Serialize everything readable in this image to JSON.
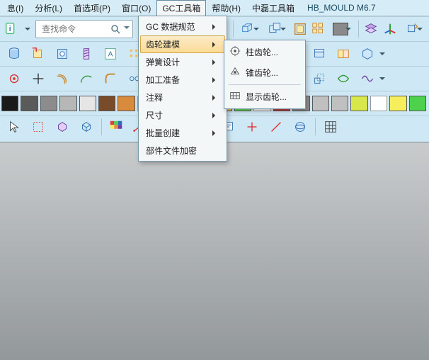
{
  "app": {
    "title": "HB_MOULD M6.7"
  },
  "menubar": {
    "items": [
      {
        "label": "息(I)"
      },
      {
        "label": "分析(L)"
      },
      {
        "label": "首选项(P)"
      },
      {
        "label": "窗口(O)"
      },
      {
        "label": "GC工具箱"
      },
      {
        "label": "帮助(H)"
      },
      {
        "label": "中磊工具箱"
      }
    ]
  },
  "search": {
    "placeholder": "查找命令",
    "value": ""
  },
  "dropdown": {
    "items": [
      {
        "label": "GC 数据规范",
        "submenu": true
      },
      {
        "label": "齿轮建模",
        "submenu": true,
        "highlight": true
      },
      {
        "label": "弹簧设计",
        "submenu": true
      },
      {
        "label": "加工准备",
        "submenu": true
      },
      {
        "label": "注释",
        "submenu": true
      },
      {
        "label": "尺寸",
        "submenu": true
      },
      {
        "label": "批量创建",
        "submenu": true
      },
      {
        "label": "部件文件加密",
        "submenu": false
      }
    ],
    "sub_items": [
      {
        "label": "柱齿轮...",
        "icon": "gear-cyl-icon"
      },
      {
        "label": "锥齿轮...",
        "icon": "gear-bevel-icon"
      },
      {
        "label": "显示齿轮...",
        "icon": "gear-show-icon"
      }
    ]
  },
  "toolbar": {
    "info_btn": "i",
    "row1_names": [
      "start-icon",
      "sketch-icon",
      "sketch-plane-icon",
      "datum-icon",
      "extrude-icon",
      "extrude-dd-icon",
      "unite-icon",
      "subtract-icon",
      "shell-icon",
      "pattern-icon",
      "mirror-icon",
      "color-dd-icon",
      "layer-icon",
      "axis-icon",
      "move-icon"
    ],
    "row2_names": [
      "cylinder-icon",
      "wrap-icon",
      "hole-icon",
      "thread-icon",
      "text-icon",
      "array-icon",
      "mesh-icon",
      "dash-icon",
      "trim-icon",
      "extend-icon",
      "fillet-icon",
      "chamfer-icon",
      "surface-icon",
      "thicken-icon",
      "sew-icon",
      "intersect-icon",
      "solid-dd-icon"
    ],
    "row3_names": [
      "sketch-symbol-icon",
      "cross-icon",
      "offset-icon",
      "arc-icon",
      "fillet2-icon",
      "chain-icon",
      "spline-icon",
      "project-icon",
      "region-icon",
      "divide-icon",
      "split-icon",
      "combine-icon",
      "pattern2-icon",
      "scale-icon",
      "gcurve-icon",
      "gsurf-icon",
      "wave-icon"
    ],
    "row5_names": [
      "cursor-icon",
      "select-rect-icon",
      "select-solid-icon",
      "wireframe-icon",
      "color-grid-icon",
      "measure-dist-icon",
      "measure-angle-icon",
      "trs-icon",
      "piv-icon",
      "note-icon",
      "plus2-icon",
      "diag-icon",
      "sphere-icon",
      "grid-icon"
    ]
  },
  "swatches": {
    "row": [
      "#1a1a1a",
      "#5a5a5a",
      "#8c8c8c",
      "#b7b7b7",
      "#e6e6e6",
      "#7a4b2a",
      "#d98b3d",
      "#ffffff",
      "#ffffff",
      "#e43c3c",
      "#f08a3c",
      "#f8df54",
      "#68e05a",
      "#ffffff",
      "#c43b3b",
      "#909090",
      "#c0c0c0",
      "#c0c0c0",
      "#d8e84a",
      "#ffffff",
      "#f6ee5c",
      "#4ed24e"
    ]
  }
}
